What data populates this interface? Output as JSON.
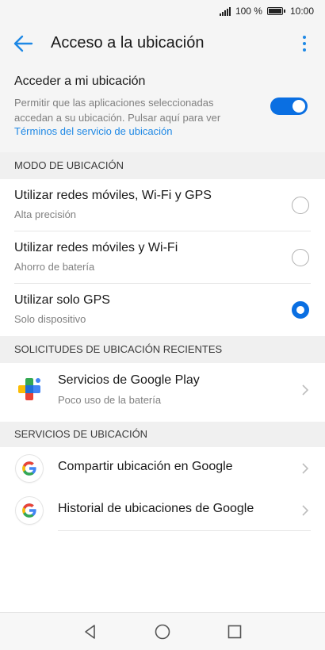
{
  "status_bar": {
    "battery_text": "100 %",
    "time": "10:00"
  },
  "header": {
    "title": "Acceso a la ubicación",
    "back_icon": "arrow-back-icon",
    "menu_icon": "more-vert-icon"
  },
  "master": {
    "title": "Acceder a mi ubicación",
    "description": "Permitir que las aplicaciones seleccionadas accedan a su ubicación. Pulsar aquí para ver",
    "link": "Términos del servicio de ubicación",
    "enabled": true
  },
  "mode_section": {
    "header": "MODO DE UBICACIÓN",
    "options": [
      {
        "title": "Utilizar redes móviles, Wi-Fi y GPS",
        "subtitle": "Alta precisión",
        "selected": false
      },
      {
        "title": "Utilizar redes móviles y Wi-Fi",
        "subtitle": "Ahorro de batería",
        "selected": false
      },
      {
        "title": "Utilizar solo GPS",
        "subtitle": "Solo dispositivo",
        "selected": true
      }
    ]
  },
  "recent_section": {
    "header": "SOLICITUDES DE UBICACIÓN RECIENTES",
    "items": [
      {
        "title": "Servicios de Google Play",
        "subtitle": "Poco uso de la batería",
        "icon": "google-play-services-icon"
      }
    ]
  },
  "services_section": {
    "header": "SERVICIOS DE UBICACIÓN",
    "items": [
      {
        "title": "Compartir ubicación en Google",
        "icon": "google-icon"
      },
      {
        "title": "Historial de ubicaciones de Google",
        "icon": "google-icon"
      }
    ]
  },
  "colors": {
    "accent": "#0a6fe2",
    "link": "#1e88e5",
    "secondary_text": "#808080"
  }
}
